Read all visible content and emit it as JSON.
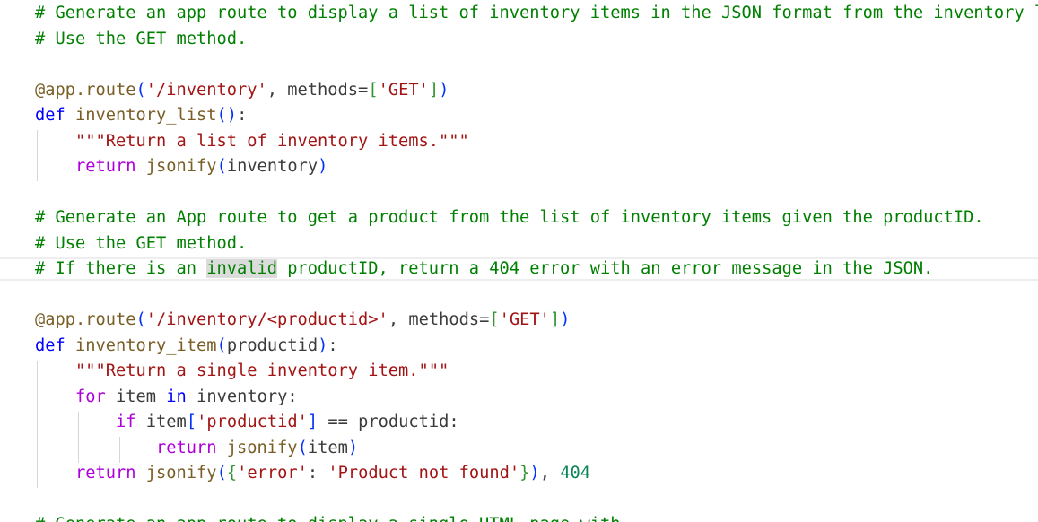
{
  "code_lines": [
    [
      {
        "c": "cm",
        "t": "# Generate an app route to display a list of inventory items in the JSON format from the inventory list."
      }
    ],
    [
      {
        "c": "cm",
        "t": "# Use the GET method."
      }
    ],
    [],
    [
      {
        "c": "fn",
        "t": "@app.route"
      },
      {
        "c": "br1",
        "t": "("
      },
      {
        "c": "str",
        "t": "'/inventory'"
      },
      {
        "c": "pl",
        "t": ", methods="
      },
      {
        "c": "br2",
        "t": "["
      },
      {
        "c": "str",
        "t": "'GET'"
      },
      {
        "c": "br2",
        "t": "]"
      },
      {
        "c": "br1",
        "t": ")"
      }
    ],
    [
      {
        "c": "kw",
        "t": "def"
      },
      {
        "c": "pl",
        "t": " "
      },
      {
        "c": "fn",
        "t": "inventory_list"
      },
      {
        "c": "br1",
        "t": "()"
      },
      {
        "c": "pl",
        "t": ":"
      }
    ],
    [
      {
        "c": "pl",
        "t": "    "
      },
      {
        "c": "str",
        "t": "\"\"\"Return a list of inventory items.\"\"\""
      }
    ],
    [
      {
        "c": "pl",
        "t": "    "
      },
      {
        "c": "ctl",
        "t": "return"
      },
      {
        "c": "pl",
        "t": " "
      },
      {
        "c": "fn",
        "t": "jsonify"
      },
      {
        "c": "br1",
        "t": "("
      },
      {
        "c": "pl",
        "t": "inventory"
      },
      {
        "c": "br1",
        "t": ")"
      }
    ],
    [],
    [
      {
        "c": "cm",
        "t": "# Generate an App route to get a product from the list of inventory items given the productID."
      }
    ],
    [
      {
        "c": "cm",
        "t": "# Use the GET method."
      }
    ],
    [
      {
        "c": "cm",
        "t": "# If there is an "
      },
      {
        "c": "cm hl",
        "t": "invalid"
      },
      {
        "c": "cm",
        "t": " productID, return a 404 error with an error message in the JSON."
      }
    ],
    [],
    [
      {
        "c": "fn",
        "t": "@app.route"
      },
      {
        "c": "br1",
        "t": "("
      },
      {
        "c": "str",
        "t": "'/inventory/<productid>'"
      },
      {
        "c": "pl",
        "t": ", methods="
      },
      {
        "c": "br2",
        "t": "["
      },
      {
        "c": "str",
        "t": "'GET'"
      },
      {
        "c": "br2",
        "t": "]"
      },
      {
        "c": "br1",
        "t": ")"
      }
    ],
    [
      {
        "c": "kw",
        "t": "def"
      },
      {
        "c": "pl",
        "t": " "
      },
      {
        "c": "fn",
        "t": "inventory_item"
      },
      {
        "c": "br1",
        "t": "("
      },
      {
        "c": "pl",
        "t": "productid"
      },
      {
        "c": "br1",
        "t": ")"
      },
      {
        "c": "pl",
        "t": ":"
      }
    ],
    [
      {
        "c": "pl",
        "t": "    "
      },
      {
        "c": "str",
        "t": "\"\"\"Return a single inventory item.\"\"\""
      }
    ],
    [
      {
        "c": "pl",
        "t": "    "
      },
      {
        "c": "ctl",
        "t": "for"
      },
      {
        "c": "pl",
        "t": " item "
      },
      {
        "c": "kw",
        "t": "in"
      },
      {
        "c": "pl",
        "t": " inventory:"
      }
    ],
    [
      {
        "c": "pl",
        "t": "        "
      },
      {
        "c": "ctl",
        "t": "if"
      },
      {
        "c": "pl",
        "t": " item"
      },
      {
        "c": "br1",
        "t": "["
      },
      {
        "c": "str",
        "t": "'productid'"
      },
      {
        "c": "br1",
        "t": "]"
      },
      {
        "c": "pl",
        "t": " == productid:"
      }
    ],
    [
      {
        "c": "pl",
        "t": "            "
      },
      {
        "c": "ctl",
        "t": "return"
      },
      {
        "c": "pl",
        "t": " "
      },
      {
        "c": "fn",
        "t": "jsonify"
      },
      {
        "c": "br1",
        "t": "("
      },
      {
        "c": "pl",
        "t": "item"
      },
      {
        "c": "br1",
        "t": ")"
      }
    ],
    [
      {
        "c": "pl",
        "t": "    "
      },
      {
        "c": "ctl",
        "t": "return"
      },
      {
        "c": "pl",
        "t": " "
      },
      {
        "c": "fn",
        "t": "jsonify"
      },
      {
        "c": "br1",
        "t": "("
      },
      {
        "c": "br2",
        "t": "{"
      },
      {
        "c": "str",
        "t": "'error'"
      },
      {
        "c": "pl",
        "t": ": "
      },
      {
        "c": "str",
        "t": "'Product not found'"
      },
      {
        "c": "br2",
        "t": "}"
      },
      {
        "c": "br1",
        "t": ")"
      },
      {
        "c": "pl",
        "t": ", "
      },
      {
        "c": "num",
        "t": "404"
      }
    ],
    [],
    [
      {
        "c": "cm",
        "t": "# Generate an app route to display a single HTML page with ..."
      }
    ]
  ],
  "highlighted_word": "invalid"
}
